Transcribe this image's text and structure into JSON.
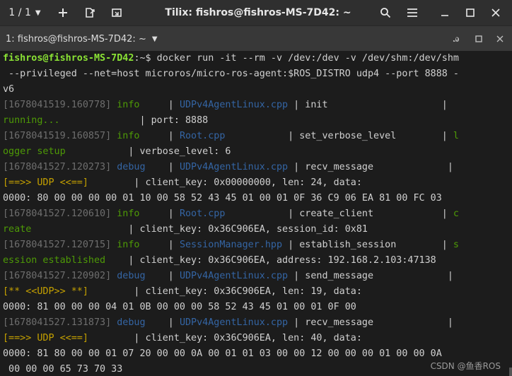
{
  "colors": {
    "prompt_user": "#8ae234",
    "ts": "#6e6e6e",
    "info": "#4e9a06",
    "debug": "#3465a4",
    "file": "#3465a4",
    "yellow": "#c4a000",
    "green": "#4e9a06",
    "text": "#d0d0d0"
  },
  "titlebar": {
    "tab_counter": "1 / 1",
    "title": "Tilix: fishros@fishros-MS-7D42: ~"
  },
  "tabbar": {
    "session_label": "1: fishros@fishros-MS-7D42: ~"
  },
  "watermark": "CSDN @鱼香ROS",
  "terminal": {
    "lines": [
      [
        {
          "t": "fishros@fishros-MS-7D42",
          "c": "prompt_user",
          "b": true
        },
        {
          "t": ":~$ docker run -it --rm -v /dev:/dev -v /dev/shm:/dev/shm",
          "c": "text"
        }
      ],
      [
        {
          "t": " --privileged --net=host microros/micro-ros-agent:$ROS_DISTRO udp4 --port 8888 -",
          "c": "text"
        }
      ],
      [
        {
          "t": "v6",
          "c": "text"
        }
      ],
      [
        {
          "t": "[1678041519.160778] ",
          "c": "ts"
        },
        {
          "t": "info",
          "c": "info"
        },
        {
          "t": "     | ",
          "c": "text"
        },
        {
          "t": "UDPv4AgentLinux.cpp",
          "c": "file"
        },
        {
          "t": " | init                    | ",
          "c": "text"
        }
      ],
      [
        {
          "t": "running...",
          "c": "green"
        },
        {
          "t": "              | port: 8888",
          "c": "text"
        }
      ],
      [
        {
          "t": "[1678041519.160857] ",
          "c": "ts"
        },
        {
          "t": "info",
          "c": "info"
        },
        {
          "t": "     | ",
          "c": "text"
        },
        {
          "t": "Root.cpp",
          "c": "file"
        },
        {
          "t": "           | set_verbose_level        | ",
          "c": "text"
        },
        {
          "t": "l",
          "c": "green"
        }
      ],
      [
        {
          "t": "ogger setup",
          "c": "green"
        },
        {
          "t": "           | verbose_level: 6",
          "c": "text"
        }
      ],
      [
        {
          "t": "[1678041527.120273] ",
          "c": "ts"
        },
        {
          "t": "debug",
          "c": "debug"
        },
        {
          "t": "    | ",
          "c": "text"
        },
        {
          "t": "UDPv4AgentLinux.cpp",
          "c": "file"
        },
        {
          "t": " | recv_message             | ",
          "c": "text"
        }
      ],
      [
        {
          "t": "[==>> UDP <<==]",
          "c": "yellow"
        },
        {
          "t": "        | client_key: 0x00000000, len: 24, data:",
          "c": "text"
        }
      ],
      [
        {
          "t": "0000: 80 00 00 00 00 01 10 00 58 52 43 45 01 00 01 0F 36 C9 06 EA 81 00 FC 03",
          "c": "text"
        }
      ],
      [
        {
          "t": "[1678041527.120610] ",
          "c": "ts"
        },
        {
          "t": "info",
          "c": "info"
        },
        {
          "t": "     | ",
          "c": "text"
        },
        {
          "t": "Root.cpp",
          "c": "file"
        },
        {
          "t": "           | create_client            | ",
          "c": "text"
        },
        {
          "t": "c",
          "c": "green"
        }
      ],
      [
        {
          "t": "reate",
          "c": "green"
        },
        {
          "t": "                 | client_key: 0x36C906EA, session_id: 0x81",
          "c": "text"
        }
      ],
      [
        {
          "t": "[1678041527.120715] ",
          "c": "ts"
        },
        {
          "t": "info",
          "c": "info"
        },
        {
          "t": "     | ",
          "c": "text"
        },
        {
          "t": "SessionManager.hpp",
          "c": "file"
        },
        {
          "t": " | establish_session        | ",
          "c": "text"
        },
        {
          "t": "s",
          "c": "green"
        }
      ],
      [
        {
          "t": "ession established",
          "c": "green"
        },
        {
          "t": "    | client_key: 0x36C906EA, address: 192.168.2.103:47138",
          "c": "text"
        }
      ],
      [
        {
          "t": "[1678041527.120902] ",
          "c": "ts"
        },
        {
          "t": "debug",
          "c": "debug"
        },
        {
          "t": "    | ",
          "c": "text"
        },
        {
          "t": "UDPv4AgentLinux.cpp",
          "c": "file"
        },
        {
          "t": " | send_message             | ",
          "c": "text"
        }
      ],
      [
        {
          "t": "[** <<UDP>> **]",
          "c": "yellow"
        },
        {
          "t": "        | client_key: 0x36C906EA, len: 19, data:",
          "c": "text"
        }
      ],
      [
        {
          "t": "0000: 81 00 00 00 04 01 0B 00 00 00 58 52 43 45 01 00 01 0F 00",
          "c": "text"
        }
      ],
      [
        {
          "t": "[1678041527.131873] ",
          "c": "ts"
        },
        {
          "t": "debug",
          "c": "debug"
        },
        {
          "t": "    | ",
          "c": "text"
        },
        {
          "t": "UDPv4AgentLinux.cpp",
          "c": "file"
        },
        {
          "t": " | recv_message             | ",
          "c": "text"
        }
      ],
      [
        {
          "t": "[==>> UDP <<==]",
          "c": "yellow"
        },
        {
          "t": "        | client_key: 0x36C906EA, len: 40, data:",
          "c": "text"
        }
      ],
      [
        {
          "t": "0000: 81 80 00 00 01 07 20 00 00 0A 00 01 01 03 00 00 12 00 00 00 01 00 00 0A",
          "c": "text"
        }
      ],
      [
        {
          "t": " 00 00 00 65 73 70 33",
          "c": "text"
        }
      ]
    ]
  }
}
